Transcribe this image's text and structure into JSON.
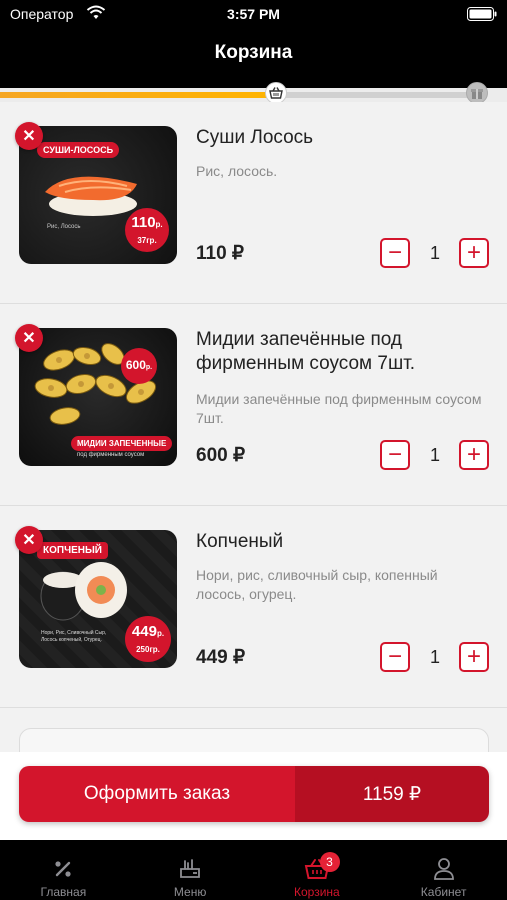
{
  "status_bar": {
    "carrier": "Оператор",
    "time": "3:57 PM"
  },
  "header": {
    "title": "Корзина"
  },
  "progress": {
    "fraction": 0.57,
    "start_icon": "basket-icon",
    "end_icon": "gift-icon",
    "fill_color": "#f5a623"
  },
  "cart": {
    "items": [
      {
        "name": "Суши Лосось",
        "description": "Рис, лосось.",
        "price": "110 ₽",
        "quantity": "1",
        "image_tag": "СУШИ-ЛОСОСЬ",
        "image_note": "Рис, Лосось",
        "image_price": "110",
        "image_currency": "р.",
        "image_weight": "37гр."
      },
      {
        "name": "Мидии запечённые под фирменным соусом 7шт.",
        "description": "Мидии запечённые под фирменным соусом 7шт.",
        "price": "600 ₽",
        "quantity": "1",
        "image_tag": "МИДИИ ЗАПЕЧЕННЫЕ",
        "image_subtag": "под фирменным соусом",
        "image_price": "600",
        "image_currency": "р."
      },
      {
        "name": "Копченый",
        "description": "Нори, рис, сливочный сыр, копенный лосось, огурец.",
        "price": "449 ₽",
        "quantity": "1",
        "image_tag": "КОПЧЕНЫЙ",
        "image_note": "Нори, Рис, Сливочный Сыр, Лосось копченый, Огурец.",
        "image_price": "449",
        "image_currency": "р.",
        "image_weight": "250гр."
      }
    ]
  },
  "checkout": {
    "label": "Оформить заказ",
    "total": "1159 ₽"
  },
  "tabs": [
    {
      "label": "Главная",
      "icon": "percent-icon"
    },
    {
      "label": "Меню",
      "icon": "menu-dish-icon"
    },
    {
      "label": "Корзина",
      "icon": "basket-icon",
      "badge": "3",
      "active": true
    },
    {
      "label": "Кабинет",
      "icon": "user-icon"
    }
  ],
  "colors": {
    "accent": "#d3152c",
    "accent_dark": "#b50f22",
    "progress": "#f5a623"
  }
}
